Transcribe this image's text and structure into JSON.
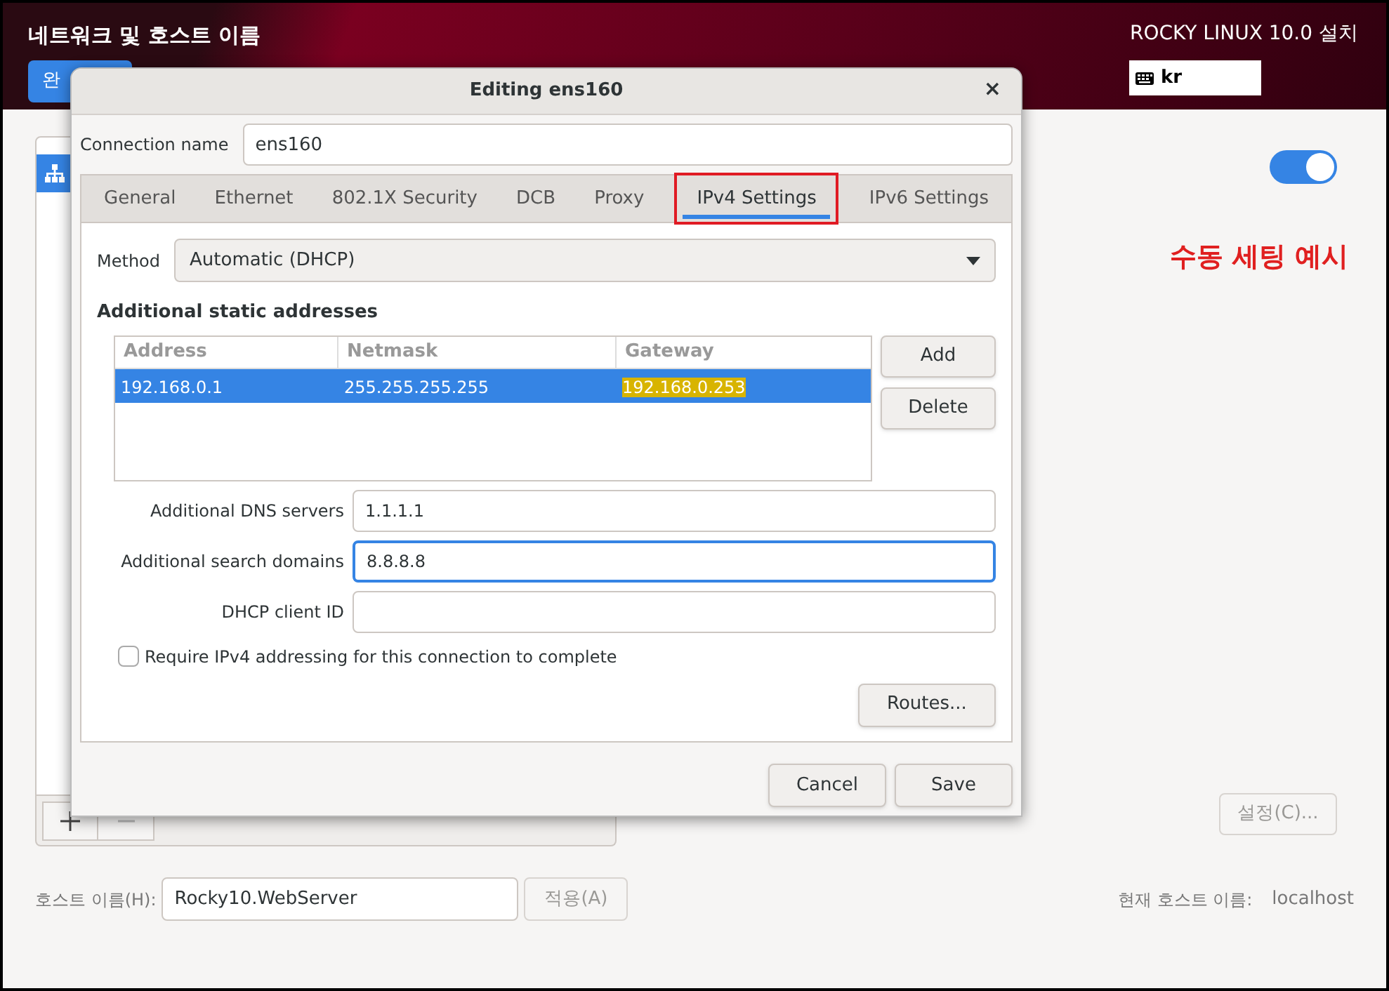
{
  "header": {
    "title": "네트워크 및 호스트 이름",
    "done_button": "완",
    "product": "ROCKY LINUX 10.0 설치",
    "keyboard": "kr"
  },
  "device_list": {
    "items": [
      {
        "selected": true
      }
    ]
  },
  "ethernet_switch": {
    "on": true
  },
  "annotation": "수동 세팅 예시",
  "configure_button": {
    "label": "설정(C)...",
    "disabled": true
  },
  "hostname": {
    "label": "호스트 이름(H):",
    "value": "Rocky10.WebServer",
    "apply": "적용(A)",
    "current_label": "현재 호스트 이름:",
    "current_value": "localhost"
  },
  "dialog": {
    "title": "Editing ens160",
    "close": "×",
    "connection_name_label": "Connection name",
    "connection_name": "ens160",
    "tabs": [
      {
        "label": "General",
        "selected": false,
        "highlighted": false
      },
      {
        "label": "Ethernet",
        "selected": false,
        "highlighted": false
      },
      {
        "label": "802.1X Security",
        "selected": false,
        "highlighted": false
      },
      {
        "label": "DCB",
        "selected": false,
        "highlighted": false
      },
      {
        "label": "Proxy",
        "selected": false,
        "highlighted": false
      },
      {
        "label": "IPv4 Settings",
        "selected": true,
        "highlighted": true
      },
      {
        "label": "IPv6 Settings",
        "selected": false,
        "highlighted": false
      }
    ],
    "method_label": "Method",
    "method": "Automatic (DHCP)",
    "addresses_title": "Additional static addresses",
    "columns": [
      "Address",
      "Netmask",
      "Gateway"
    ],
    "rows": [
      {
        "cells": [
          {
            "text": "192.168.0.1",
            "highlighted": false
          },
          {
            "text": "255.255.255.255",
            "highlighted": false
          },
          {
            "text": "192.168.0.253",
            "highlighted": true
          }
        ],
        "selected": true
      }
    ],
    "add": "Add",
    "delete": "Delete",
    "fields": [
      {
        "label": "Additional DNS servers",
        "value": "1.1.1.1",
        "focused": false
      },
      {
        "label": "Additional search domains",
        "value": "8.8.8.8",
        "focused": true
      },
      {
        "label": "DHCP client ID",
        "focused": false
      }
    ],
    "require": {
      "label": "Require IPv4 addressing for this connection to complete",
      "checked": false
    },
    "routes": "Routes...",
    "cancel": "Cancel",
    "save": "Save"
  }
}
